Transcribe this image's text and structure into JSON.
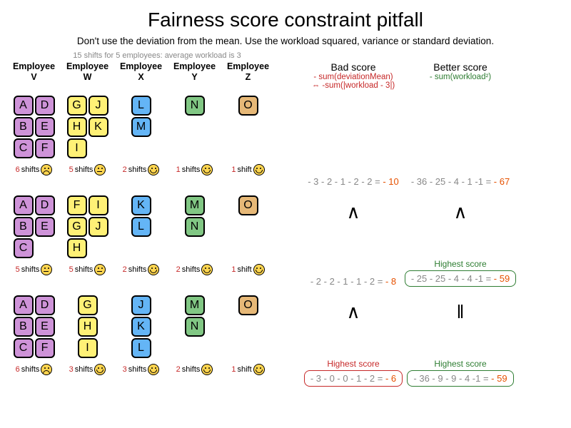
{
  "title": "Fairness score constraint pitfall",
  "subtitle": "Don't use the deviation from the mean. Use the workload squared, variance or standard deviation.",
  "hint": "15 shifts for 5 employees: average workload is 3",
  "employees": [
    {
      "name": "Employee",
      "sub": "V",
      "color": "c0"
    },
    {
      "name": "Employee",
      "sub": "W",
      "color": "c1"
    },
    {
      "name": "Employee",
      "sub": "X",
      "color": "c2"
    },
    {
      "name": "Employee",
      "sub": "Y",
      "color": "c3"
    },
    {
      "name": "Employee",
      "sub": "Z",
      "color": "c4"
    }
  ],
  "bad": {
    "title": "Bad score",
    "formula": "- sum(deviationMean)",
    "equiv": "⇔ -sum(|workload - 3|)"
  },
  "better": {
    "title": "Better score",
    "formula": "- sum(workload²)"
  },
  "highest": "Highest score",
  "rows": [
    {
      "cells": [
        {
          "stacks": [
            [
              "A",
              "B",
              "C"
            ],
            [
              "D",
              "E",
              "F"
            ]
          ],
          "n": 6,
          "unit": "shifts",
          "mood": "sad"
        },
        {
          "stacks": [
            [
              "G",
              "H",
              "I"
            ],
            [
              "J",
              "K"
            ]
          ],
          "n": 5,
          "unit": "shifts",
          "mood": "meh"
        },
        {
          "stacks": [
            [
              "L",
              "M"
            ]
          ],
          "n": 2,
          "unit": "shifts",
          "mood": "happy"
        },
        {
          "stacks": [
            [
              "N"
            ]
          ],
          "n": 1,
          "unit": "shifts",
          "mood": "happy"
        },
        {
          "stacks": [
            [
              "O"
            ]
          ],
          "n": 1,
          "unit": "shift",
          "mood": "happy"
        }
      ],
      "bad": {
        "calc": "- 3 - 2 - 1 - 2 - 2 = ",
        "val": "- 10",
        "cmp": "",
        "box": false,
        "hl": false
      },
      "better": {
        "calc": "- 36 - 25 - 4 - 1 -1 = ",
        "val": "- 67",
        "cmp": "",
        "box": false,
        "hl": false
      }
    },
    {
      "cells": [
        {
          "stacks": [
            [
              "A",
              "B",
              "C"
            ],
            [
              "D",
              "E"
            ]
          ],
          "n": 5,
          "unit": "shifts",
          "mood": "meh"
        },
        {
          "stacks": [
            [
              "F",
              "G",
              "H"
            ],
            [
              "I",
              "J"
            ]
          ],
          "n": 5,
          "unit": "shifts",
          "mood": "meh"
        },
        {
          "stacks": [
            [
              "K",
              "L"
            ]
          ],
          "n": 2,
          "unit": "shifts",
          "mood": "happy"
        },
        {
          "stacks": [
            [
              "M",
              "N"
            ]
          ],
          "n": 2,
          "unit": "shifts",
          "mood": "happy"
        },
        {
          "stacks": [
            [
              "O"
            ]
          ],
          "n": 1,
          "unit": "shift",
          "mood": "happy"
        }
      ],
      "bad": {
        "calc": "- 2 - 2 - 1 - 1 - 2 = ",
        "val": "- 8",
        "cmp": "∧",
        "box": false,
        "hl": false
      },
      "better": {
        "calc": "- 25 - 25 - 4 - 4 -1 = ",
        "val": "- 59",
        "cmp": "∧",
        "box": true,
        "hl": true
      }
    },
    {
      "cells": [
        {
          "stacks": [
            [
              "A",
              "B",
              "C"
            ],
            [
              "D",
              "E",
              "F"
            ]
          ],
          "n": 6,
          "unit": "shifts",
          "mood": "sad"
        },
        {
          "stacks": [
            [
              "G",
              "H",
              "I"
            ]
          ],
          "n": 3,
          "unit": "shifts",
          "mood": "happy"
        },
        {
          "stacks": [
            [
              "J",
              "K",
              "L"
            ]
          ],
          "n": 3,
          "unit": "shifts",
          "mood": "happy"
        },
        {
          "stacks": [
            [
              "M",
              "N"
            ]
          ],
          "n": 2,
          "unit": "shifts",
          "mood": "happy"
        },
        {
          "stacks": [
            [
              "O"
            ]
          ],
          "n": 1,
          "unit": "shift",
          "mood": "happy"
        }
      ],
      "bad": {
        "calc": "- 3 - 0 - 0 - 1 - 2 = ",
        "val": "- 6",
        "cmp": "∧",
        "box": true,
        "hl": true
      },
      "better": {
        "calc": "- 36 - 9 - 9 - 4 -1 = ",
        "val": "- 59",
        "cmp": "‖",
        "box": true,
        "hl": true
      }
    }
  ]
}
